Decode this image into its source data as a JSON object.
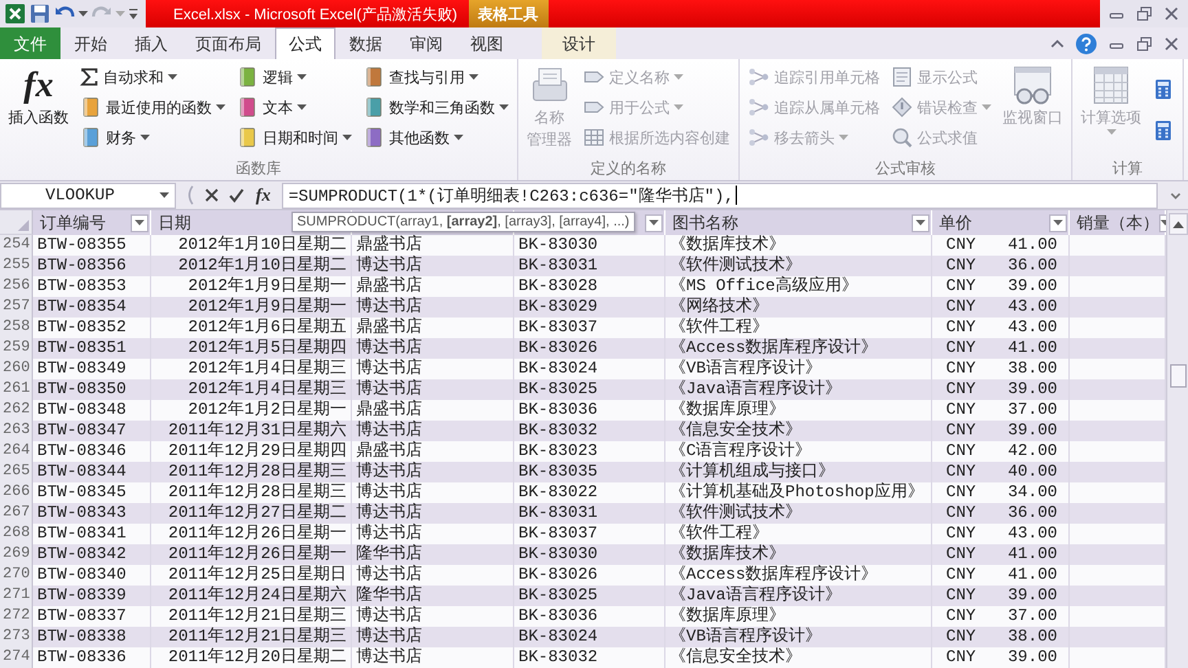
{
  "title_bar": {
    "title": "Excel.xlsx  -  Microsoft Excel(产品激活失败)",
    "context_tab": "表格工具"
  },
  "ribbon_tabs": [
    {
      "label": "文件",
      "kind": "file",
      "selected": false
    },
    {
      "label": "开始",
      "kind": "normal",
      "selected": false
    },
    {
      "label": "插入",
      "kind": "normal",
      "selected": false
    },
    {
      "label": "页面布局",
      "kind": "normal",
      "selected": false
    },
    {
      "label": "公式",
      "kind": "normal",
      "selected": true
    },
    {
      "label": "数据",
      "kind": "normal",
      "selected": false
    },
    {
      "label": "审阅",
      "kind": "normal",
      "selected": false
    },
    {
      "label": "视图",
      "kind": "normal",
      "selected": false
    },
    {
      "label": "设计",
      "kind": "context",
      "selected": false
    }
  ],
  "ribbon_groups": [
    {
      "label": "函数库",
      "buttons": [
        {
          "kind": "large",
          "glyph": "fx",
          "label_lines": [
            "插入函数"
          ],
          "dropdown": false,
          "disabled": false
        },
        {
          "kind": "column",
          "items": [
            {
              "label": "自动求和",
              "dropdown": true,
              "disabled": false
            },
            {
              "label": "最近使用的函数",
              "dropdown": true,
              "disabled": false
            },
            {
              "label": "财务",
              "dropdown": true,
              "disabled": false
            }
          ]
        },
        {
          "kind": "column",
          "items": [
            {
              "label": "逻辑",
              "dropdown": true,
              "disabled": false
            },
            {
              "label": "文本",
              "dropdown": true,
              "disabled": false
            },
            {
              "label": "日期和时间",
              "dropdown": true,
              "disabled": false
            }
          ]
        },
        {
          "kind": "column",
          "items": [
            {
              "label": "查找与引用",
              "dropdown": true,
              "disabled": false
            },
            {
              "label": "数学和三角函数",
              "dropdown": true,
              "disabled": false
            },
            {
              "label": "其他函数",
              "dropdown": true,
              "disabled": false
            }
          ]
        }
      ]
    },
    {
      "label": "定义的名称",
      "buttons": [
        {
          "kind": "large",
          "label_lines": [
            "名称",
            "管理器"
          ],
          "dropdown": false,
          "disabled": true
        },
        {
          "kind": "column",
          "items": [
            {
              "label": "定义名称",
              "dropdown": true,
              "disabled": true
            },
            {
              "label": "用于公式",
              "dropdown": true,
              "disabled": true
            },
            {
              "label": "根据所选内容创建",
              "dropdown": false,
              "disabled": true
            }
          ]
        }
      ]
    },
    {
      "label": "公式审核",
      "buttons": [
        {
          "kind": "column",
          "items": [
            {
              "label": "追踪引用单元格",
              "dropdown": false,
              "disabled": true
            },
            {
              "label": "追踪从属单元格",
              "dropdown": false,
              "disabled": true
            },
            {
              "label": "移去箭头",
              "dropdown": true,
              "disabled": true
            }
          ]
        },
        {
          "kind": "column",
          "items": [
            {
              "label": "显示公式",
              "dropdown": false,
              "disabled": true
            },
            {
              "label": "错误检查",
              "dropdown": true,
              "disabled": true
            },
            {
              "label": "公式求值",
              "dropdown": false,
              "disabled": true
            }
          ]
        },
        {
          "kind": "large",
          "label_lines": [
            "监视窗口"
          ],
          "dropdown": false,
          "disabled": true
        }
      ]
    },
    {
      "label": "计算",
      "buttons": [
        {
          "kind": "large",
          "label_lines": [
            "计算选项"
          ],
          "dropdown": true,
          "disabled": true
        },
        {
          "kind": "icon_column",
          "items": [
            {
              "disabled": false
            },
            {
              "disabled": false
            }
          ]
        }
      ]
    }
  ],
  "formula_bar": {
    "name_box": "VLOOKUP",
    "function_button": "fx",
    "formula": "=SUMPRODUCT(1*(订单明细表!C263:c636=\"隆华书店\"),"
  },
  "tooltip": "SUMPRODUCT(array1, **[array2]**, [array3], [array4], ...)",
  "columns": [
    {
      "label": "订单编号",
      "filter": true
    },
    {
      "label": "日期",
      "filter": false
    },
    {
      "filter": false
    },
    {
      "filter": true
    },
    {
      "label": "图书名称",
      "filter": true
    },
    {
      "label": "单价",
      "filter": true
    },
    {
      "label": "销量（本）",
      "filter": true
    }
  ],
  "rows": [
    {
      "number": "254",
      "cells": [
        "BTW-08355",
        "2012年1月10日星期二",
        "鼎盛书店",
        "BK-83030",
        "《数据库技术》"
      ],
      "currency": "CNY",
      "price": "41.00"
    },
    {
      "number": "255",
      "cells": [
        "BTW-08356",
        "2012年1月10日星期二",
        "博达书店",
        "BK-83031",
        "《软件测试技术》"
      ],
      "currency": "CNY",
      "price": "36.00"
    },
    {
      "number": "256",
      "cells": [
        "BTW-08353",
        "2012年1月9日星期一",
        "鼎盛书店",
        "BK-83028",
        "《MS Office高级应用》"
      ],
      "currency": "CNY",
      "price": "39.00"
    },
    {
      "number": "257",
      "cells": [
        "BTW-08354",
        "2012年1月9日星期一",
        "博达书店",
        "BK-83029",
        "《网络技术》"
      ],
      "currency": "CNY",
      "price": "43.00"
    },
    {
      "number": "258",
      "cells": [
        "BTW-08352",
        "2012年1月6日星期五",
        "鼎盛书店",
        "BK-83037",
        "《软件工程》"
      ],
      "currency": "CNY",
      "price": "43.00"
    },
    {
      "number": "259",
      "cells": [
        "BTW-08351",
        "2012年1月5日星期四",
        "博达书店",
        "BK-83026",
        "《Access数据库程序设计》"
      ],
      "currency": "CNY",
      "price": "41.00"
    },
    {
      "number": "260",
      "cells": [
        "BTW-08349",
        "2012年1月4日星期三",
        "博达书店",
        "BK-83024",
        "《VB语言程序设计》"
      ],
      "currency": "CNY",
      "price": "38.00"
    },
    {
      "number": "261",
      "cells": [
        "BTW-08350",
        "2012年1月4日星期三",
        "博达书店",
        "BK-83025",
        "《Java语言程序设计》"
      ],
      "currency": "CNY",
      "price": "39.00"
    },
    {
      "number": "262",
      "cells": [
        "BTW-08348",
        "2012年1月2日星期一",
        "鼎盛书店",
        "BK-83036",
        "《数据库原理》"
      ],
      "currency": "CNY",
      "price": "37.00"
    },
    {
      "number": "263",
      "cells": [
        "BTW-08347",
        "2011年12月31日星期六",
        "博达书店",
        "BK-83032",
        "《信息安全技术》"
      ],
      "currency": "CNY",
      "price": "39.00"
    },
    {
      "number": "264",
      "cells": [
        "BTW-08346",
        "2011年12月29日星期四",
        "鼎盛书店",
        "BK-83023",
        "《C语言程序设计》"
      ],
      "currency": "CNY",
      "price": "42.00"
    },
    {
      "number": "265",
      "cells": [
        "BTW-08344",
        "2011年12月28日星期三",
        "博达书店",
        "BK-83035",
        "《计算机组成与接口》"
      ],
      "currency": "CNY",
      "price": "40.00"
    },
    {
      "number": "266",
      "cells": [
        "BTW-08345",
        "2011年12月28日星期三",
        "博达书店",
        "BK-83022",
        "《计算机基础及Photoshop应用》"
      ],
      "currency": "CNY",
      "price": "34.00"
    },
    {
      "number": "267",
      "cells": [
        "BTW-08343",
        "2011年12月27日星期二",
        "博达书店",
        "BK-83031",
        "《软件测试技术》"
      ],
      "currency": "CNY",
      "price": "36.00"
    },
    {
      "number": "268",
      "cells": [
        "BTW-08341",
        "2011年12月26日星期一",
        "博达书店",
        "BK-83037",
        "《软件工程》"
      ],
      "currency": "CNY",
      "price": "43.00"
    },
    {
      "number": "269",
      "cells": [
        "BTW-08342",
        "2011年12月26日星期一",
        "隆华书店",
        "BK-83030",
        "《数据库技术》"
      ],
      "currency": "CNY",
      "price": "41.00"
    },
    {
      "number": "270",
      "cells": [
        "BTW-08340",
        "2011年12月25日星期日",
        "博达书店",
        "BK-83026",
        "《Access数据库程序设计》"
      ],
      "currency": "CNY",
      "price": "41.00"
    },
    {
      "number": "271",
      "cells": [
        "BTW-08339",
        "2011年12月24日星期六",
        "隆华书店",
        "BK-83025",
        "《Java语言程序设计》"
      ],
      "currency": "CNY",
      "price": "39.00"
    },
    {
      "number": "272",
      "cells": [
        "BTW-08337",
        "2011年12月21日星期三",
        "博达书店",
        "BK-83036",
        "《数据库原理》"
      ],
      "currency": "CNY",
      "price": "37.00"
    },
    {
      "number": "273",
      "cells": [
        "BTW-08338",
        "2011年12月21日星期三",
        "博达书店",
        "BK-83024",
        "《VB语言程序设计》"
      ],
      "currency": "CNY",
      "price": "38.00"
    },
    {
      "number": "274",
      "cells": [
        "BTW-08336",
        "2011年12月20日星期二",
        "博达书店",
        "BK-83032",
        "《信息安全技术》"
      ],
      "currency": "CNY",
      "price": "39.00"
    }
  ]
}
